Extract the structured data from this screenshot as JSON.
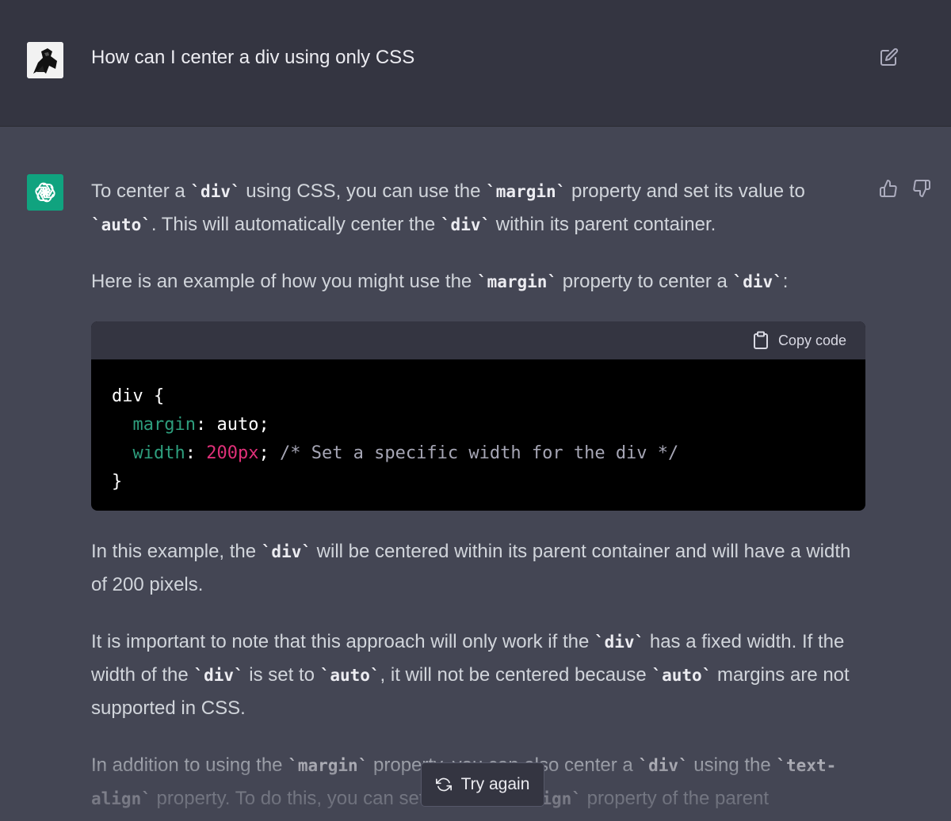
{
  "user_message": {
    "text": "How can I center a div using only CSS",
    "avatar_icon": "user-avatar-icon",
    "edit_icon": "edit-icon"
  },
  "assistant": {
    "avatar_icon": "openai-logo-icon",
    "thumbs_up_icon": "thumbs-up-icon",
    "thumbs_down_icon": "thumbs-down-icon",
    "para1": [
      {
        "t": "text",
        "v": "To center a "
      },
      {
        "t": "code",
        "v": "`div`"
      },
      {
        "t": "text",
        "v": " using CSS, you can use the "
      },
      {
        "t": "code",
        "v": "`margin`"
      },
      {
        "t": "text",
        "v": " property and set its value to "
      },
      {
        "t": "code",
        "v": "`auto`"
      },
      {
        "t": "text",
        "v": ". This will automatically center the "
      },
      {
        "t": "code",
        "v": "`div`"
      },
      {
        "t": "text",
        "v": " within its parent container."
      }
    ],
    "para2": [
      {
        "t": "text",
        "v": "Here is an example of how you might use the "
      },
      {
        "t": "code",
        "v": "`margin`"
      },
      {
        "t": "text",
        "v": " property to center a "
      },
      {
        "t": "code",
        "v": "`div`"
      },
      {
        "t": "text",
        "v": ":"
      }
    ],
    "code_block": {
      "copy_label": "Copy code",
      "copy_icon": "clipboard-icon",
      "lines": [
        [
          {
            "c": "",
            "v": "div {"
          }
        ],
        [
          {
            "c": "",
            "v": "  "
          },
          {
            "c": "prop",
            "v": "margin"
          },
          {
            "c": "",
            "v": ": auto;"
          }
        ],
        [
          {
            "c": "",
            "v": "  "
          },
          {
            "c": "prop",
            "v": "width"
          },
          {
            "c": "",
            "v": ": "
          },
          {
            "c": "num",
            "v": "200px"
          },
          {
            "c": "",
            "v": "; "
          },
          {
            "c": "com",
            "v": "/* Set a specific width for the div */"
          }
        ],
        [
          {
            "c": "",
            "v": "}"
          }
        ]
      ]
    },
    "para3": [
      {
        "t": "text",
        "v": "In this example, the "
      },
      {
        "t": "code",
        "v": "`div`"
      },
      {
        "t": "text",
        "v": " will be centered within its parent container and will have a width of 200 pixels."
      }
    ],
    "para4": [
      {
        "t": "text",
        "v": "It is important to note that this approach will only work if the "
      },
      {
        "t": "code",
        "v": "`div`"
      },
      {
        "t": "text",
        "v": " has a fixed width. If the width of the "
      },
      {
        "t": "code",
        "v": "`div`"
      },
      {
        "t": "text",
        "v": " is set to "
      },
      {
        "t": "code",
        "v": "`auto`"
      },
      {
        "t": "text",
        "v": ", it will not be centered because "
      },
      {
        "t": "code",
        "v": "`auto`"
      },
      {
        "t": "text",
        "v": " margins are not supported in CSS."
      }
    ],
    "para5": [
      {
        "t": "text",
        "v": "In addition to using the "
      },
      {
        "t": "code",
        "v": "`margin`"
      },
      {
        "t": "text",
        "v": " property, you can also center a "
      },
      {
        "t": "code",
        "v": "`div`"
      },
      {
        "t": "text",
        "v": " using the "
      },
      {
        "t": "code",
        "v": "`text-align`"
      },
      {
        "t": "text",
        "v": " property. To do this, you can set the "
      },
      {
        "t": "code",
        "v": "`text-align`"
      },
      {
        "t": "text",
        "v": " property of the parent"
      }
    ]
  },
  "try_again": {
    "label": "Try again",
    "icon": "refresh-icon"
  },
  "colors": {
    "user_bg": "#343541",
    "assistant_bg": "#444654",
    "avatar_green": "#10a37f",
    "code_property": "#2e9e7d",
    "code_number": "#df3079"
  }
}
